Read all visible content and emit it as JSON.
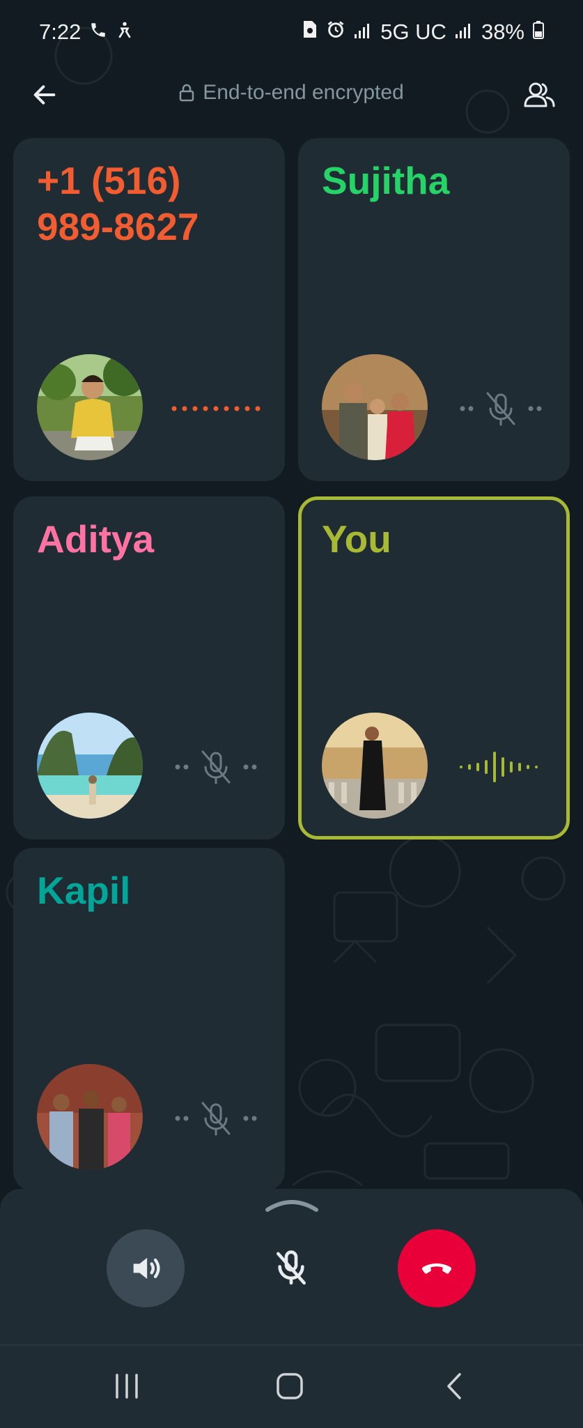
{
  "status_bar": {
    "time": "7:22",
    "network": "5G UC",
    "battery": "38%",
    "icons": [
      "phone-icon",
      "accessibility-icon",
      "sim-icon",
      "alarm-icon",
      "signal-icon",
      "signal-icon",
      "battery-icon"
    ]
  },
  "header": {
    "encryption_text": "End-to-end encrypted",
    "icons": [
      "back-arrow-icon",
      "lock-icon",
      "participants-icon"
    ]
  },
  "participants": [
    {
      "name": "+1 (516) 989-8627",
      "name_color": "#f15c31",
      "status": "connecting",
      "indicator_color": "#f15c31"
    },
    {
      "name": "Sujitha",
      "name_color": "#25d366",
      "status": "muted"
    },
    {
      "name": "Aditya",
      "name_color": "#ff72a1",
      "status": "muted"
    },
    {
      "name": "You",
      "name_color": "#a8b933",
      "status": "speaking",
      "active": true,
      "indicator_color": "#a8b933"
    },
    {
      "name": "Kapil",
      "name_color": "#02a698",
      "status": "muted"
    }
  ],
  "controls": {
    "speaker": "speaker-icon",
    "mute": "mic-off-icon",
    "end_call": "end-call-icon",
    "end_call_color": "#ea0038"
  },
  "nav": {
    "items": [
      "recent-apps-icon",
      "home-icon",
      "back-icon"
    ]
  }
}
